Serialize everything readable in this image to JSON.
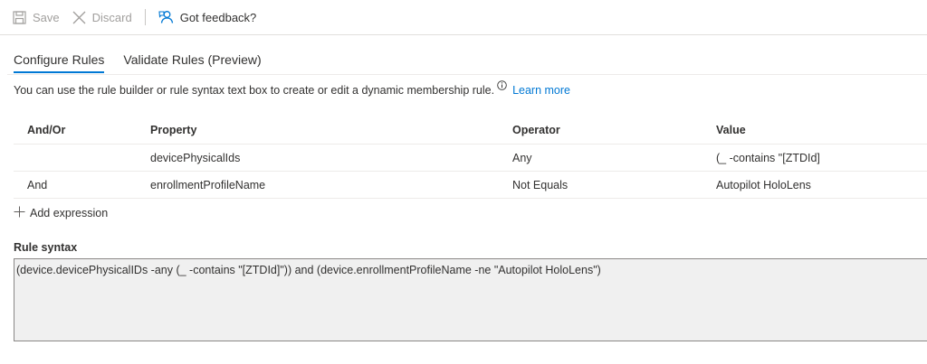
{
  "toolbar": {
    "save_label": "Save",
    "discard_label": "Discard",
    "feedback_label": "Got feedback?"
  },
  "tabs": [
    {
      "label": "Configure Rules",
      "active": true
    },
    {
      "label": "Validate Rules (Preview)",
      "active": false
    }
  ],
  "description": {
    "text": "You can use the rule builder or rule syntax text box to create or edit a dynamic membership rule.",
    "link": "Learn more"
  },
  "table": {
    "headers": [
      "And/Or",
      "Property",
      "Operator",
      "Value"
    ],
    "rows": [
      {
        "and_or": "",
        "property": "devicePhysicalIds",
        "operator": "Any",
        "value": "(_ -contains \"[ZTDId]"
      },
      {
        "and_or": "And",
        "property": "enrollmentProfileName",
        "operator": "Not Equals",
        "value": "Autopilot HoloLens"
      }
    ]
  },
  "add_expression_label": "Add expression",
  "rule_syntax": {
    "label": "Rule syntax",
    "value": "(device.devicePhysicalIDs -any (_ -contains \"[ZTDId]\")) and (device.enrollmentProfileName -ne \"Autopilot HoloLens\")"
  },
  "colors": {
    "accent": "#0078d4",
    "disabled": "#a19f9d",
    "text": "#323130"
  },
  "icons": [
    "save-icon",
    "discard-icon",
    "feedback-icon",
    "info-icon",
    "add-icon"
  ]
}
